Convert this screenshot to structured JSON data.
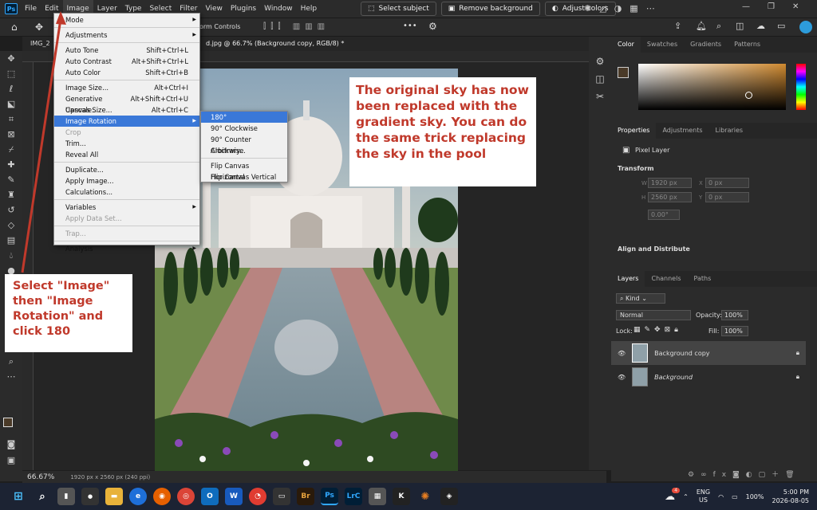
{
  "menubar": {
    "logo": "Ps",
    "items": [
      "File",
      "Edit",
      "Image",
      "Layer",
      "Type",
      "Select",
      "Filter",
      "View",
      "Plugins",
      "Window",
      "Help"
    ],
    "context_buttons": [
      "Select subject",
      "Remove background",
      "Adjust colors"
    ]
  },
  "options": {
    "transform_controls": "orm Controls"
  },
  "document": {
    "tab_left": "IMG_2",
    "tab_title": "d.jpg @ 66.7% (Background copy, RGB/8) *"
  },
  "image_menu": {
    "items": [
      {
        "label": "Mode",
        "shortcut": "",
        "submenu": true
      },
      {
        "label": "Adjustments",
        "shortcut": "",
        "submenu": true
      },
      {
        "label": "Auto Tone",
        "shortcut": "Shift+Ctrl+L"
      },
      {
        "label": "Auto Contrast",
        "shortcut": "Alt+Shift+Ctrl+L"
      },
      {
        "label": "Auto Color",
        "shortcut": "Shift+Ctrl+B"
      },
      {
        "label": "Image Size...",
        "shortcut": "Alt+Ctrl+I"
      },
      {
        "label": "Generative Upscale...",
        "shortcut": "Alt+Shift+Ctrl+U"
      },
      {
        "label": "Canvas Size...",
        "shortcut": "Alt+Ctrl+C"
      },
      {
        "label": "Image Rotation",
        "shortcut": "",
        "submenu": true
      },
      {
        "label": "Crop",
        "shortcut": ""
      },
      {
        "label": "Trim...",
        "shortcut": ""
      },
      {
        "label": "Reveal All",
        "shortcut": ""
      },
      {
        "label": "Duplicate...",
        "shortcut": ""
      },
      {
        "label": "Apply Image...",
        "shortcut": ""
      },
      {
        "label": "Calculations...",
        "shortcut": ""
      },
      {
        "label": "Variables",
        "shortcut": "",
        "submenu": true
      },
      {
        "label": "Apply Data Set...",
        "shortcut": ""
      },
      {
        "label": "Trap...",
        "shortcut": ""
      },
      {
        "label": "Analysis",
        "shortcut": "",
        "submenu": true
      }
    ]
  },
  "rotation_submenu": [
    "180°",
    "90° Clockwise",
    "90° Counter Clockwise",
    "Arbitrary...",
    "Flip Canvas Horizontal",
    "Flip Canvas Vertical"
  ],
  "annotations": {
    "note1": "The original sky has now been replaced with the gradient sky. You can do the same trick replacing the sky in the pool",
    "note2": "Select \"Image\" then \"Image Rotation\" and click 180"
  },
  "status": {
    "zoom": "66.67%",
    "info": "1920 px x 2560 px (240 ppi)"
  },
  "color_panel": {
    "tabs": [
      "Color",
      "Swatches",
      "Gradients",
      "Patterns"
    ]
  },
  "properties": {
    "tabs": [
      "Properties",
      "Adjustments",
      "Libraries"
    ],
    "kind": "Pixel Layer",
    "transform_title": "Transform",
    "w": "1920 px",
    "h": "2560 px",
    "x": "0 px",
    "y": "0 px",
    "angle": "0.00°",
    "align_title": "Align and Distribute"
  },
  "layers": {
    "tabs": [
      "Layers",
      "Channels",
      "Paths"
    ],
    "filter_kind": "Kind",
    "blend_mode": "Normal",
    "opacity_label": "Opacity:",
    "opacity": "100%",
    "lock_label": "Lock:",
    "fill_label": "Fill:",
    "fill": "100%",
    "items": [
      {
        "name": "Background copy"
      },
      {
        "name": "Background"
      }
    ]
  },
  "taskbar": {
    "apps": [
      "Br",
      "Ps",
      "LrC"
    ],
    "lang": "ENG",
    "region": "US",
    "battery": "100%",
    "time": "5:00 PM",
    "date": "2026-08-05",
    "weather_badge": "4"
  },
  "colors": {
    "accent": "#3a78d8",
    "annotation_red": "#c0392b",
    "arrow": "#c0392b",
    "fg_swatch": "#4a3a28"
  }
}
